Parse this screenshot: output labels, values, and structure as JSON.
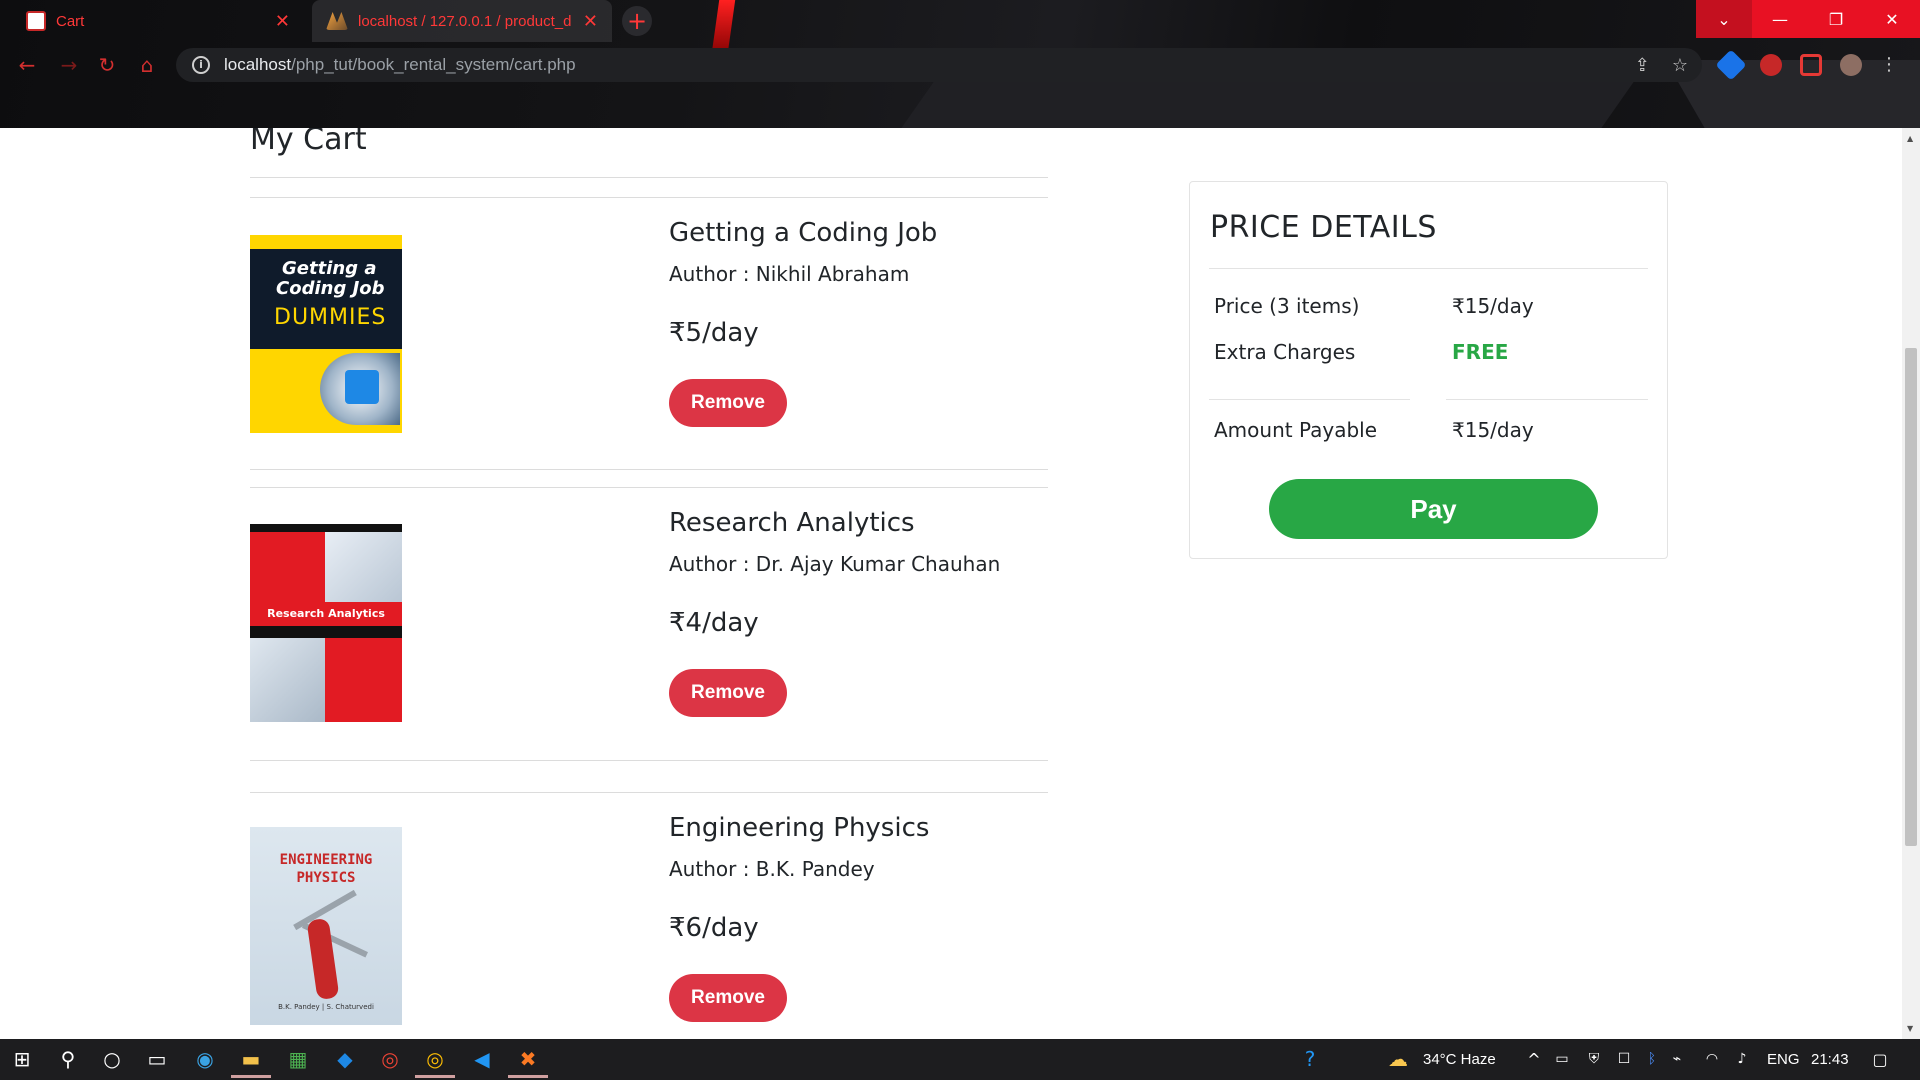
{
  "browser": {
    "tabs": [
      {
        "title": "Cart",
        "active": false
      },
      {
        "title": "localhost / 127.0.0.1 / product_d",
        "active": true
      }
    ],
    "url_host": "localhost",
    "url_path": "/php_tut/book_rental_system/cart.php"
  },
  "page": {
    "heading": "My Cart",
    "cart_items": [
      {
        "title": "Getting a Coding Job",
        "author": "Author : Nikhil Abraham",
        "price": "₹5/day",
        "remove_label": "Remove",
        "cover": {
          "line1": "Getting a",
          "line2": "Coding Job",
          "line3": "DUMMIES"
        }
      },
      {
        "title": "Research Analytics",
        "author": "Author : Dr. Ajay Kumar Chauhan",
        "price": "₹4/day",
        "remove_label": "Remove",
        "cover": {
          "line1": "Research Analytics"
        }
      },
      {
        "title": "Engineering Physics",
        "author": "Author : B.K. Pandey",
        "price": "₹6/day",
        "remove_label": "Remove",
        "cover": {
          "line1": "ENGINEERING",
          "line2": "PHYSICS",
          "line3": "B.K. Pandey | S. Chaturvedi"
        }
      }
    ],
    "price_details": {
      "heading": "PRICE DETAILS",
      "price_label": "Price (3 items)",
      "price_value": "₹15/day",
      "extra_label": "Extra Charges",
      "extra_value": "FREE",
      "payable_label": "Amount Payable",
      "payable_value": "₹15/day",
      "pay_label": "Pay"
    }
  },
  "taskbar": {
    "weather": "34°C  Haze",
    "language": "ENG",
    "time": "21:43"
  },
  "colors": {
    "remove": "#dc3545",
    "pay": "#28a745",
    "free": "#28a745"
  }
}
